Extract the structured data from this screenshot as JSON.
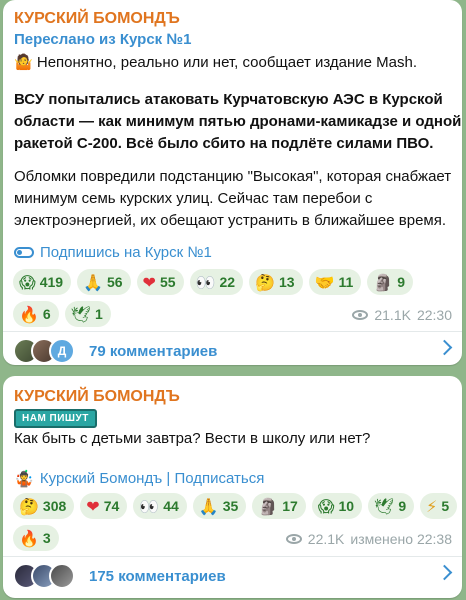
{
  "post1": {
    "channel": "КУРСКИЙ БОМОНДЪ",
    "forwarded": "Переслано из Курск №1",
    "intro_emoji": "🤷",
    "intro": "Непонятно, реально или нет, сообщает издание Mash.",
    "bold_lines": [
      "ВСУ попытались атаковать Курчатовскую АЭС в Курской",
      "области — как минимум пятью дронами-камикадзе и одной",
      "ракетой С-200. Всё было сбито на подлёте силами ПВО."
    ],
    "lines": [
      "Обломки повредили подстанцию \"Высокая\", которая снабжает",
      "минимум семь курских улиц. Сейчас там перебои с",
      "электроэнергией, их обещают устранить в ближайшее время."
    ],
    "subscribe": "Подпишись на Курск №1",
    "reactions": [
      {
        "emoji": "😱",
        "count": "419"
      },
      {
        "emoji": "🙏",
        "count": "56"
      },
      {
        "emoji": "❤",
        "count": "55"
      },
      {
        "emoji": "👀",
        "count": "22"
      },
      {
        "emoji": "🤔",
        "count": "13"
      },
      {
        "emoji": "🤝",
        "count": "11"
      },
      {
        "emoji": "🗿",
        "count": "9"
      },
      {
        "emoji": "🔥",
        "count": "6"
      },
      {
        "emoji": "🕊",
        "count": "1"
      }
    ],
    "views": "21.1K",
    "time": "22:30",
    "comments": "79 комментариев",
    "avatar_letter": "Д"
  },
  "post2": {
    "channel": "КУРСКИЙ БОМОНДЪ",
    "badge": "НАМ ПИШУТ",
    "text": "Как быть с детьми завтра? Вести в школу или нет?",
    "subscribe_emoji": "🤹",
    "subscribe": "Курский Бомондъ | Подписаться",
    "reactions": [
      {
        "emoji": "🤔",
        "count": "308"
      },
      {
        "emoji": "❤",
        "count": "74"
      },
      {
        "emoji": "👀",
        "count": "44"
      },
      {
        "emoji": "🙏",
        "count": "35"
      },
      {
        "emoji": "🗿",
        "count": "17"
      },
      {
        "emoji": "😱",
        "count": "10"
      },
      {
        "emoji": "🕊",
        "count": "9"
      },
      {
        "emoji": "⚡",
        "count": "5"
      },
      {
        "emoji": "🔥",
        "count": "3"
      }
    ],
    "views": "22.1K",
    "time": "изменено 22:38",
    "comments": "175 комментариев"
  },
  "colors": {
    "background": "#8fb68a",
    "channel": "#e0751f",
    "link": "#3a8fd0",
    "reaction_bg": "#e6f1e3",
    "reaction_text": "#2c7a2e"
  }
}
